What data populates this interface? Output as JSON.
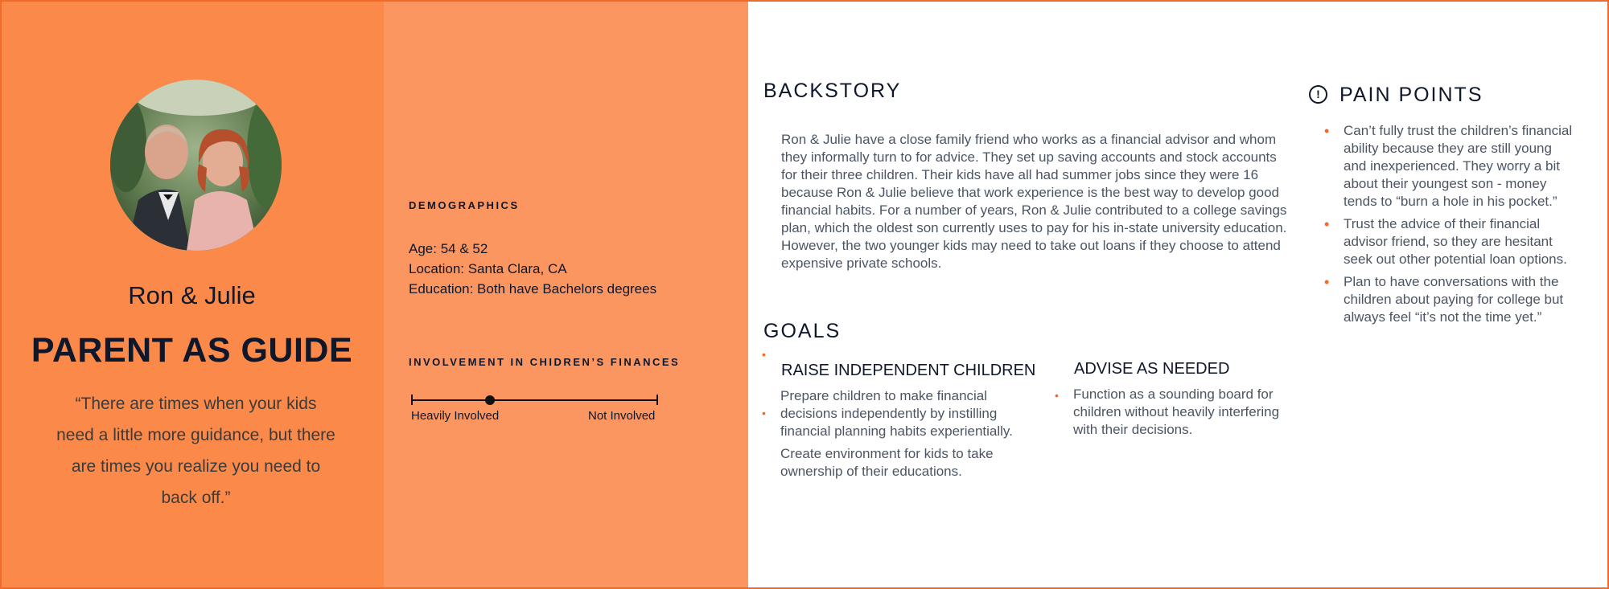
{
  "persona": {
    "name": "Ron & Julie",
    "title": "PARENT AS GUIDE",
    "quote": "“There are times when your kids need a little more guidance, but there are times you realize you need to back off.”"
  },
  "demographics": {
    "heading": "DEMOGRAPHICS",
    "lines": [
      "Age: 54 & 52",
      "Location: Santa Clara, CA",
      "Education: Both have Bachelors degrees"
    ]
  },
  "involvement": {
    "heading": "INVOLVEMENT IN CHIDREN’S FINANCES",
    "left_label": "Heavily Involved",
    "right_label": "Not Involved",
    "level": 0.32
  },
  "backstory": {
    "heading": "BACKSTORY",
    "text": "Ron & Julie have a close family friend who works as a financial advisor and whom they informally turn to for advice. They set up saving accounts and stock accounts for their three children. Their kids have all had summer jobs since they were 16 because Ron & Julie believe that work experience is the best way to develop good financial habits. For a number of years, Ron & Julie contributed to a college savings plan, which the oldest son currently uses to pay for his in-state university education. However, the two younger kids may need to take out loans if they choose to attend expensive private schools."
  },
  "goals": {
    "heading": "GOALS",
    "items": [
      {
        "title": "RAISE INDEPENDENT CHILDREN",
        "text1": "Prepare children to make financial decisions independently by instilling financial planning habits experientially.",
        "text2": "Create environment for kids to take ownership of their educations."
      },
      {
        "title": "ADVISE AS NEEDED",
        "text1": "Function as a sounding board for children without heavily interfering with their decisions."
      }
    ]
  },
  "pain_points": {
    "heading": "PAIN POINTS",
    "items": [
      "Can’t fully trust the children’s financial ability because they are still young and inexperienced. They worry a bit about their youngest son - money tends to “burn a hole in his pocket.”",
      "Trust the advice of their financial advisor friend, so they are hesitant seek out other potential loan options.",
      "Plan to have conversations with the children about paying for college but always feel “it’s not the time yet.”"
    ]
  },
  "colors": {
    "left_panel": "#fb8a4a",
    "mid_panel": "#fc9660",
    "accent": "#f26a2a"
  },
  "icons": {
    "avatar": "couple-photo",
    "pain_points": "exclamation-circle-icon"
  }
}
